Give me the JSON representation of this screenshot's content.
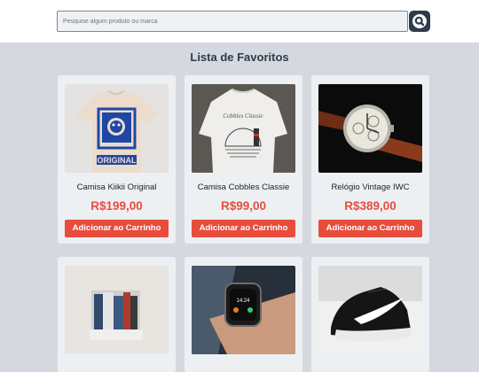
{
  "search": {
    "placeholder": "Pesquise algum produto ou marca"
  },
  "icons": {
    "search_button": "search-icon",
    "shoe_brand_logo": "swoosh"
  },
  "colors": {
    "accent": "#e74c3c",
    "header_bg": "#ffffff",
    "page_bg": "#d5d9df",
    "search_button_bg": "#2f3b4b"
  },
  "page": {
    "title": "Lista de Favoritos"
  },
  "products": [
    {
      "name": "Camisa Kiikii Original",
      "price": "R$199,00",
      "button": "Adicionar ao Carrinho",
      "image": "white t-shirt with blue cat print",
      "print_text": "ORIGINAL"
    },
    {
      "name": "Camisa Cobbles Classie",
      "price": "R$99,00",
      "button": "Adicionar ao Carrinho",
      "image": "man wearing white t-shirt with sunset line art",
      "print_text": "Cobbles Classie"
    },
    {
      "name": "Relógio Vintage IWC",
      "price": "R$389,00",
      "button": "Adicionar ao Carrinho",
      "image": "vintage wristwatch with brown leather strap"
    },
    {
      "name": "",
      "price": "",
      "button": "",
      "image": "folded jeans and clothing stack"
    },
    {
      "name": "",
      "price": "",
      "button": "",
      "image": "smartwatch on wrist",
      "screen_time": "14:24"
    },
    {
      "name": "",
      "price": "",
      "button": "",
      "image": "black sneaker with white swoosh"
    }
  ]
}
